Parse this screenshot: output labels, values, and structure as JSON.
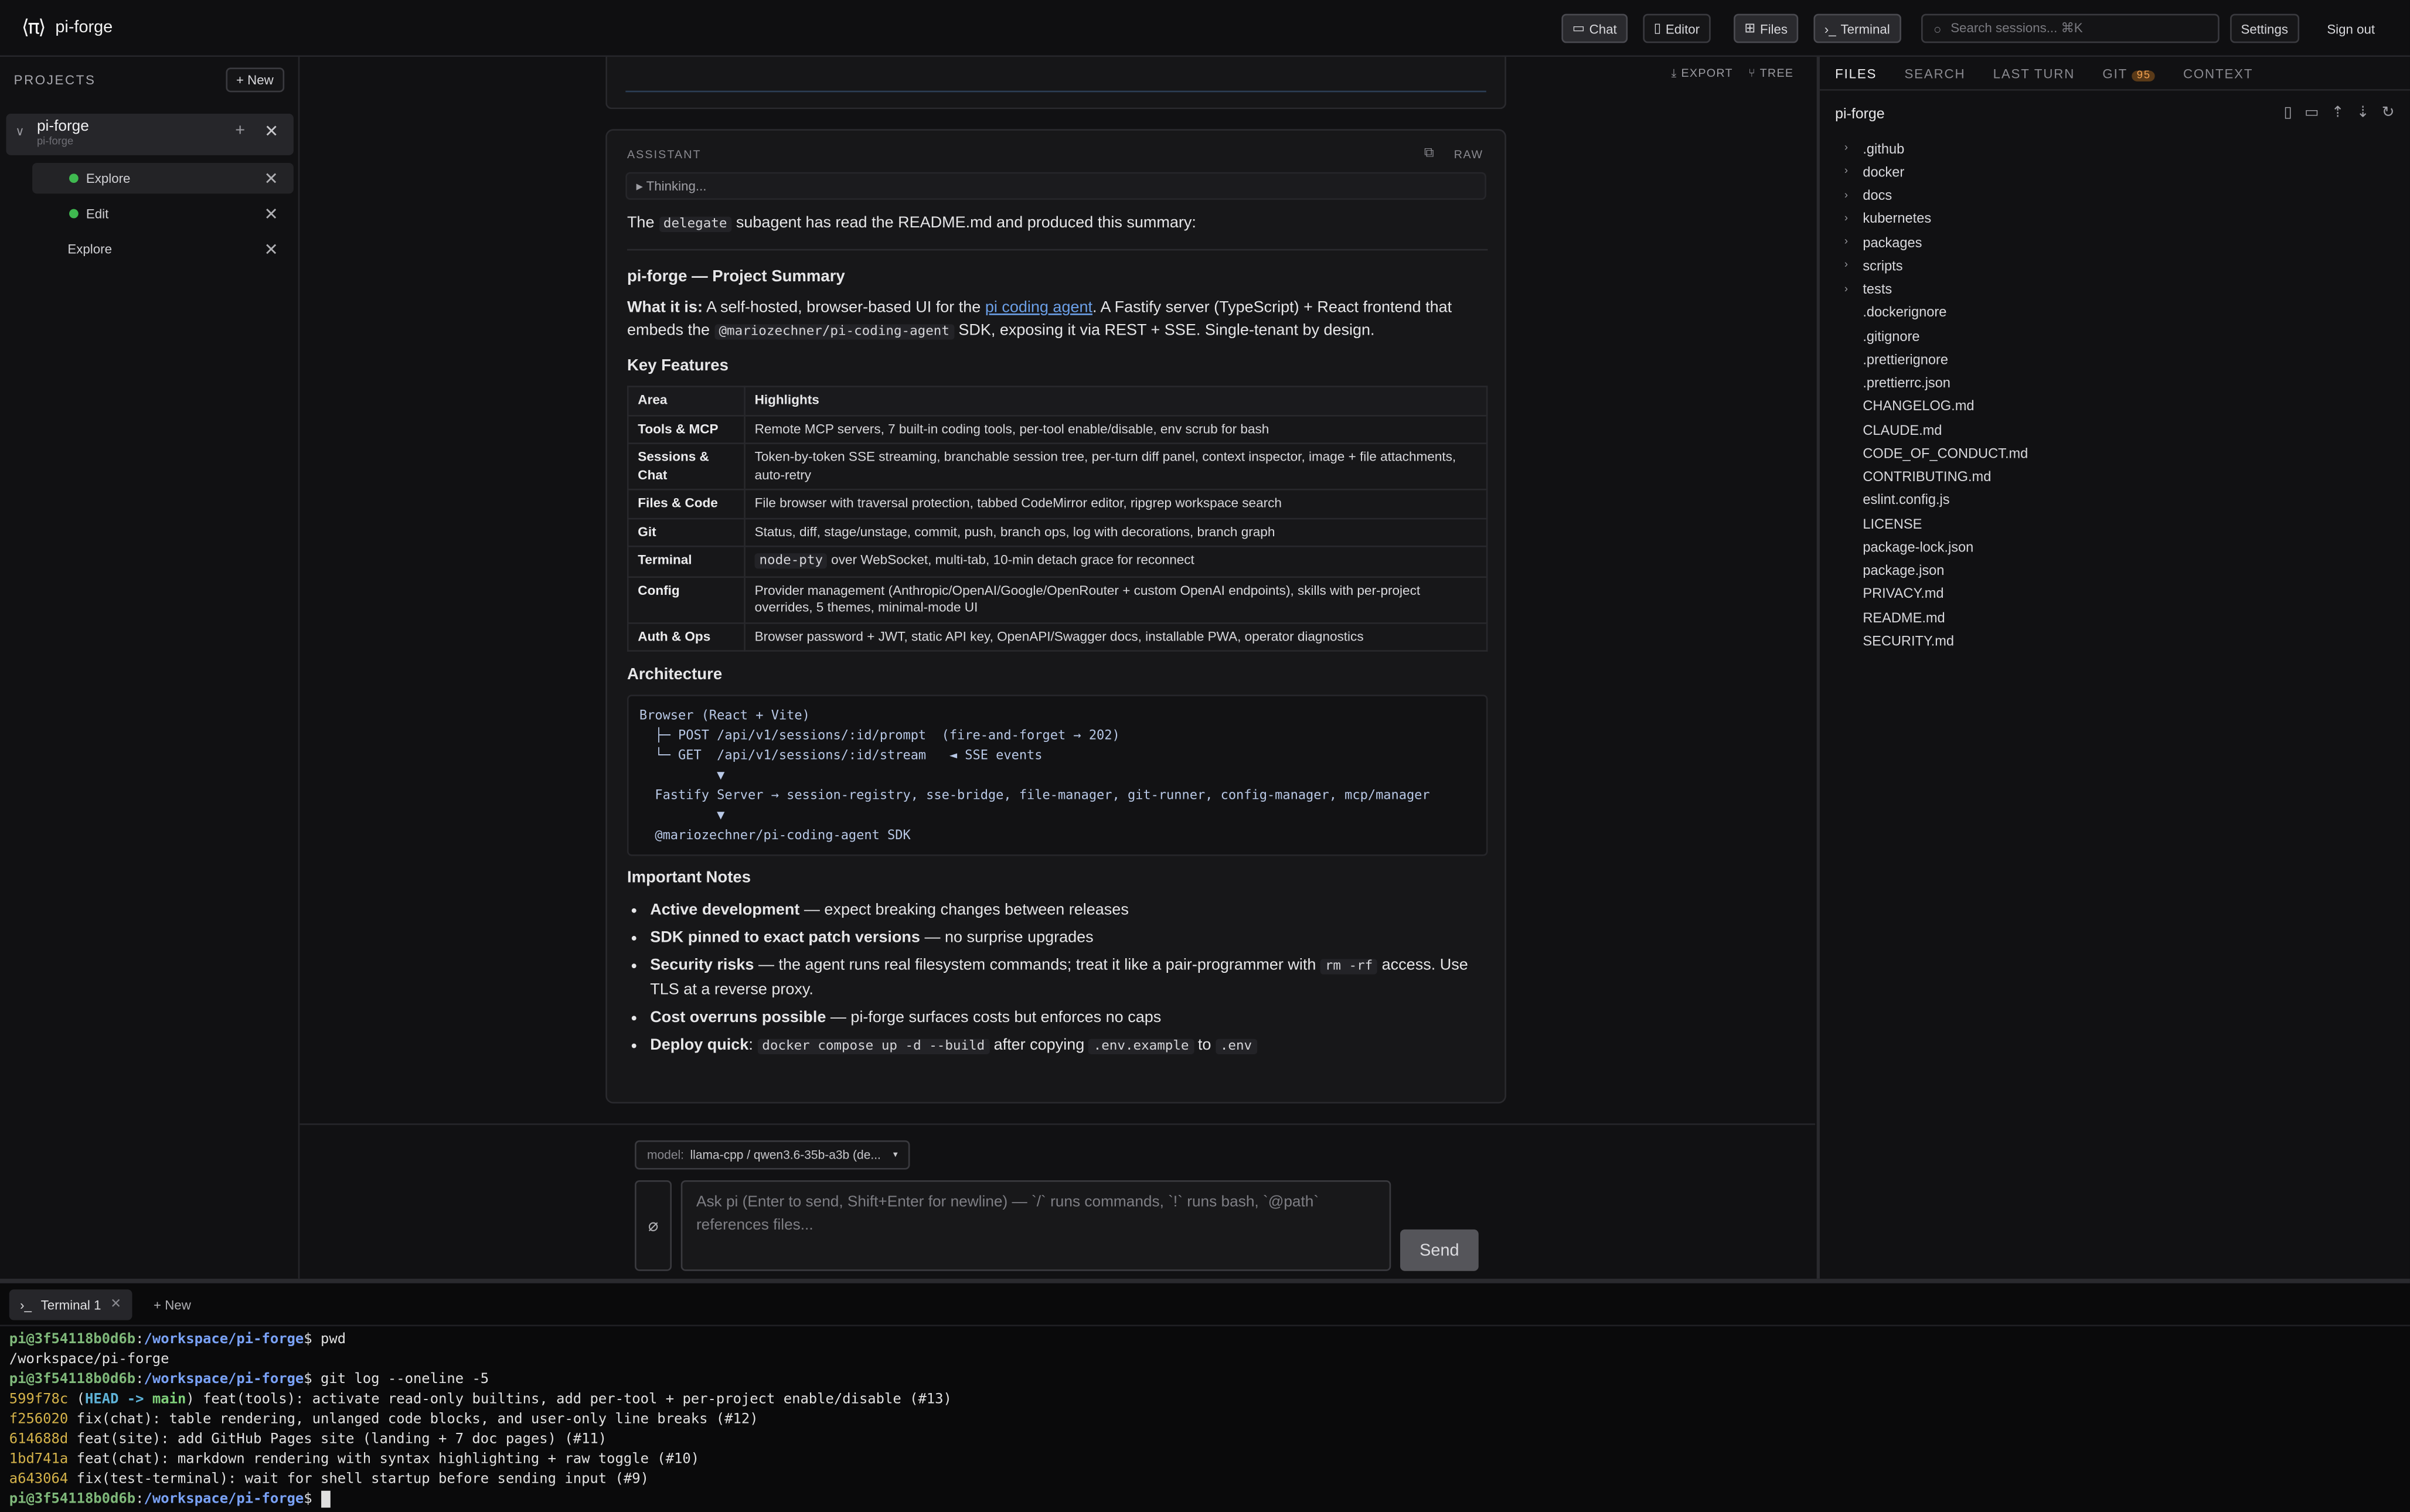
{
  "app": {
    "name": "pi-forge",
    "logo_glyph": "⟨π⟩"
  },
  "topbar": {
    "chat": "Chat",
    "editor": "Editor",
    "files": "Files",
    "terminal": "Terminal",
    "search_placeholder": "Search sessions... ⌘K",
    "settings": "Settings",
    "signout": "Sign out"
  },
  "sidebar": {
    "title": "PROJECTS",
    "new_label": "+ New",
    "project": {
      "name": "pi-forge",
      "path": "pi-forge"
    },
    "sessions": [
      {
        "label": "Explore",
        "active": true,
        "running": true
      },
      {
        "label": "Edit",
        "running": true
      },
      {
        "label": "Explore"
      }
    ]
  },
  "main": {
    "export": "EXPORT",
    "tree": "TREE"
  },
  "message": {
    "role": "ASSISTANT",
    "raw": "RAW",
    "thinking": "▸ Thinking...",
    "intro_pre": "The",
    "intro_code": "delegate",
    "intro_post": "subagent has read the README.md and produced this summary:",
    "title": "pi-forge — Project Summary",
    "what_label": "What it is:",
    "what_pre": "A self-hosted, browser-based UI for the",
    "what_link": "pi coding agent",
    "what_mid": ". A Fastify server (TypeScript) + React frontend that embeds the",
    "what_code": "@mariozechner/pi-coding-agent",
    "what_post": "SDK, exposing it via REST + SSE. Single-tenant by design.",
    "features_heading": "Key Features",
    "table_head": [
      "Area",
      "Highlights"
    ],
    "rows": [
      {
        "area": "Tools & MCP",
        "hl": "Remote MCP servers, 7 built-in coding tools, per-tool enable/disable, env scrub for bash"
      },
      {
        "area": "Sessions & Chat",
        "hl": "Token-by-token SSE streaming, branchable session tree, per-turn diff panel, context inspector, image + file attachments, auto-retry"
      },
      {
        "area": "Files & Code",
        "hl": "File browser with traversal protection, tabbed CodeMirror editor, ripgrep workspace search"
      },
      {
        "area": "Git",
        "hl": "Status, diff, stage/unstage, commit, push, branch ops, log with decorations, branch graph"
      },
      {
        "area": "Terminal",
        "hl_code": "node-pty",
        "hl": "over WebSocket, multi-tab, 10-min detach grace for reconnect"
      },
      {
        "area": "Config",
        "hl": "Provider management (Anthropic/OpenAI/Google/OpenRouter + custom OpenAI endpoints), skills with per-project overrides, 5 themes, minimal-mode UI"
      },
      {
        "area": "Auth & Ops",
        "hl": "Browser password + JWT, static API key, OpenAPI/Swagger docs, installable PWA, operator diagnostics"
      }
    ],
    "arch_heading": "Architecture",
    "arch_code": "Browser (React + Vite)\n  ├─ POST /api/v1/sessions/:id/prompt  (fire-and-forget → 202)\n  └─ GET  /api/v1/sessions/:id/stream   ◄ SSE events\n          ▼\n  Fastify Server → session-registry, sse-bridge, file-manager, git-runner, config-manager, mcp/manager\n          ▼\n  @mariozechner/pi-coding-agent SDK",
    "notes_heading": "Important Notes",
    "notes": [
      {
        "b": "Active development",
        "t": "— expect breaking changes between releases"
      },
      {
        "b": "SDK pinned to exact patch versions",
        "t": "— no surprise upgrades"
      },
      {
        "b": "Security risks",
        "t": "— the agent runs real filesystem commands; treat it like a pair-programmer with",
        "code": "rm -rf",
        "t2": "access. Use TLS at a reverse proxy."
      },
      {
        "b": "Cost overruns possible",
        "t": "— pi-forge surfaces costs but enforces no caps"
      },
      {
        "b": "Deploy quick",
        "t": ":",
        "code": "docker compose up -d --build",
        "t2": "after copying",
        "code2": ".env.example",
        "t3": "to",
        "code3": ".env"
      }
    ]
  },
  "composer": {
    "model_label": "model:",
    "model_value": "llama-cpp / qwen3.6-35b-a3b (de...",
    "placeholder": "Ask pi (Enter to send, Shift+Enter for newline) — `/` runs commands, `!` runs bash, `@path` references files...",
    "send": "Send"
  },
  "files_panel": {
    "tabs": [
      "FILES",
      "SEARCH",
      "LAST TURN",
      "GIT",
      "CONTEXT"
    ],
    "git_badge": "95",
    "root": "pi-forge",
    "folders": [
      ".github",
      "docker",
      "docs",
      "kubernetes",
      "packages",
      "scripts",
      "tests"
    ],
    "files": [
      ".dockerignore",
      ".gitignore",
      ".prettierignore",
      ".prettierrc.json",
      "CHANGELOG.md",
      "CLAUDE.md",
      "CODE_OF_CONDUCT.md",
      "CONTRIBUTING.md",
      "eslint.config.js",
      "LICENSE",
      "package-lock.json",
      "package.json",
      "PRIVACY.md",
      "README.md",
      "SECURITY.md"
    ]
  },
  "terminal": {
    "tab": "Terminal 1",
    "new": "+ New",
    "user": "pi@3f54118b0d6b",
    "path": "/workspace/pi-forge",
    "cmd1": "pwd",
    "out1": "/workspace/pi-forge",
    "cmd2": "git log --oneline -5",
    "log": [
      {
        "hash": "599f78c",
        "head": "HEAD -> main",
        "msg": "feat(tools): activate read-only builtins, add per-tool + per-project enable/disable (#13)"
      },
      {
        "hash": "f256020",
        "msg": "fix(chat): table rendering, unlanged code blocks, and user-only line breaks (#12)"
      },
      {
        "hash": "614688d",
        "msg": "feat(site): add GitHub Pages site (landing + 7 doc pages) (#11)"
      },
      {
        "hash": "1bd741a",
        "msg": "feat(chat): markdown rendering with syntax highlighting + raw toggle (#10)"
      },
      {
        "hash": "a643064",
        "msg": "fix(test-terminal): wait for shell startup before sending input (#9)"
      }
    ]
  }
}
